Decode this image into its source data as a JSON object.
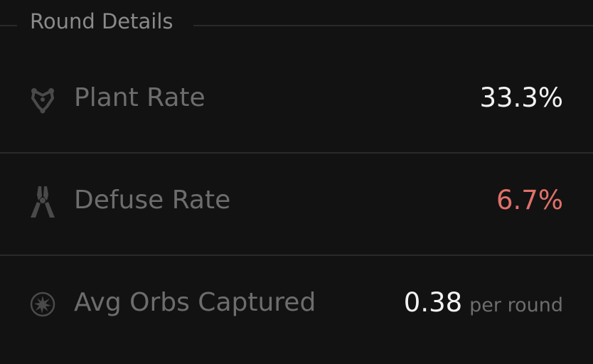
{
  "section": {
    "title": "Round Details"
  },
  "stats": [
    {
      "label": "Plant Rate",
      "value": "33.3%",
      "icon": "spike-icon",
      "value_color": "#f2f2f2"
    },
    {
      "label": "Defuse Rate",
      "value": "6.7%",
      "icon": "defuser-icon",
      "value_color": "#e0706a"
    },
    {
      "label": "Avg Orbs Captured",
      "value": "0.38",
      "unit": "per round",
      "icon": "orb-icon",
      "value_color": "#f2f2f2"
    }
  ],
  "colors": {
    "background": "#121212",
    "divider": "#2a2a2a",
    "label": "#6d6d6d",
    "value": "#f2f2f2",
    "negative": "#e0706a"
  }
}
